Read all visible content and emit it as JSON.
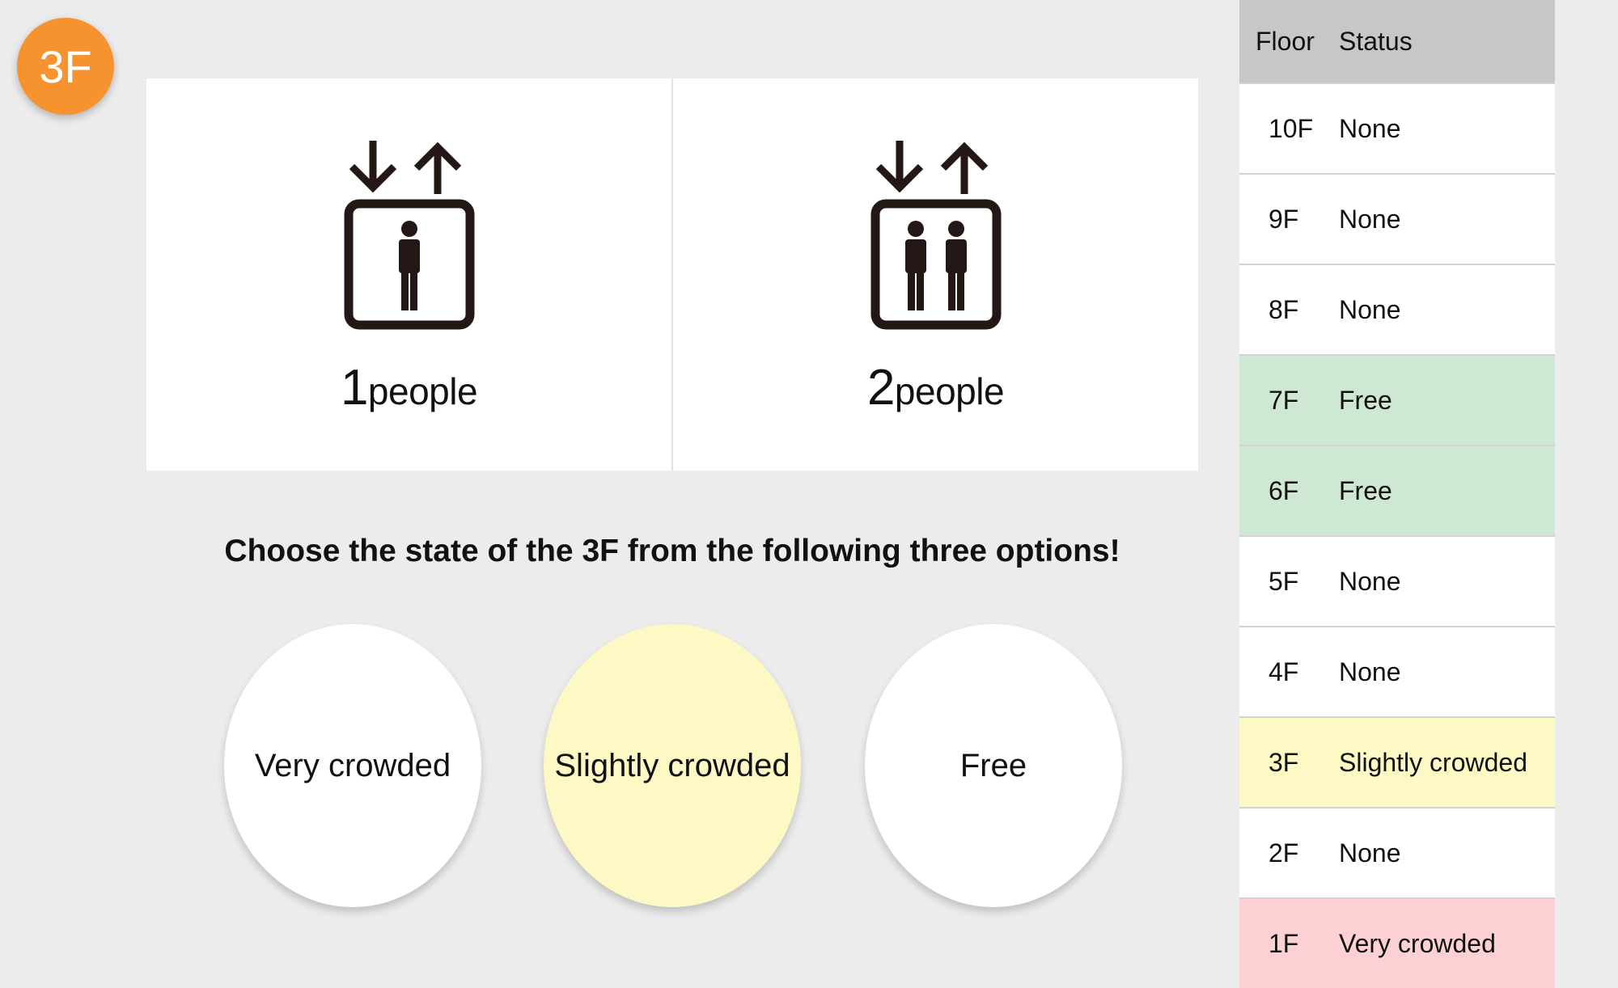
{
  "current_floor": "3F",
  "panels": [
    {
      "count": "1",
      "unit": "people",
      "icon": "elevator-1-person-icon"
    },
    {
      "count": "2",
      "unit": "people",
      "icon": "elevator-2-people-icon"
    }
  ],
  "prompt": "Choose the state of the 3F from the following three options!",
  "options": [
    {
      "label": "Very crowded",
      "selected": false
    },
    {
      "label": "Slightly crowded",
      "selected": true
    },
    {
      "label": "Free",
      "selected": false
    }
  ],
  "table": {
    "headers": {
      "floor": "Floor",
      "status": "Status"
    },
    "rows": [
      {
        "floor": "10F",
        "status": "None"
      },
      {
        "floor": "9F",
        "status": "None"
      },
      {
        "floor": "8F",
        "status": "None"
      },
      {
        "floor": "7F",
        "status": "Free"
      },
      {
        "floor": "6F",
        "status": "Free"
      },
      {
        "floor": "5F",
        "status": "None"
      },
      {
        "floor": "4F",
        "status": "None"
      },
      {
        "floor": "3F",
        "status": "Slightly crowded"
      },
      {
        "floor": "2F",
        "status": "None"
      },
      {
        "floor": "1F",
        "status": "Very crowded"
      }
    ]
  },
  "colors": {
    "badge": "#f7932f",
    "free": "#cfe8d4",
    "slightly_crowded": "#fdf8c4",
    "very_crowded": "#fdd1d4",
    "none": "#ffffff",
    "header": "#c7c7c7"
  }
}
